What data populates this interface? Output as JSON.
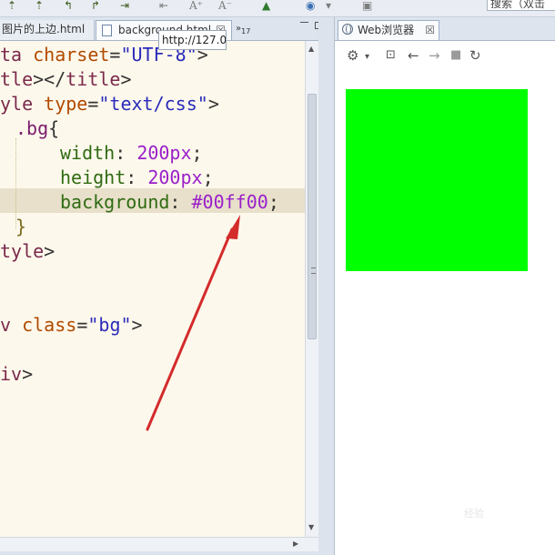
{
  "toolbar": {
    "search_text": "搜索（双击",
    "icons": [
      "arrow-icon",
      "arrow-icon",
      "arrow-icon",
      "arrow-icon",
      "arrow-icon",
      "arrow-icon",
      "font-increase-icon",
      "font-decrease-icon",
      "globe-icon",
      "page-icon"
    ]
  },
  "editor": {
    "tabs": [
      {
        "label": "图片的上边.html"
      },
      {
        "label": "background.html",
        "close": "☒"
      },
      {
        "label": "»",
        "count": "17"
      }
    ],
    "lines": {
      "l1": {
        "tag": "ta ",
        "attr": "charset",
        "eq": "=",
        "str": "\"UTF-8\"",
        "end": ">"
      },
      "l2": {
        "tag": "tle",
        "mid": "></",
        "tag2": "title",
        "end": ">"
      },
      "l3": {
        "tag": "yle ",
        "attr": "type",
        "eq": "=",
        "str": "\"text/css\"",
        "end": ">"
      },
      "l4": {
        "sel": ".bg",
        "brace": "{"
      },
      "l5": {
        "prop": "width",
        "colon": ": ",
        "val": "200px",
        "semi": ";"
      },
      "l6": {
        "prop": "height",
        "colon": ": ",
        "val": "200px",
        "semi": ";"
      },
      "l7": {
        "prop": "background",
        "colon": ": ",
        "val": "#00ff00",
        "semi": ";"
      },
      "l8": {
        "brace": "}"
      },
      "l9": {
        "tag": "tyle",
        "end": ">"
      },
      "l10": {
        "tag": "v ",
        "attr": "class",
        "eq": "=",
        "str": "\"bg\"",
        "end": ">"
      },
      "l11": {
        "tag": "iv",
        "end": ">"
      }
    }
  },
  "browser": {
    "tab_label": "Web浏览器",
    "tab_close": "☒",
    "url": "http://127.0",
    "box_color": "#00ff00"
  },
  "annotation": {
    "color": "#d42b2b"
  },
  "watermark": "经验"
}
